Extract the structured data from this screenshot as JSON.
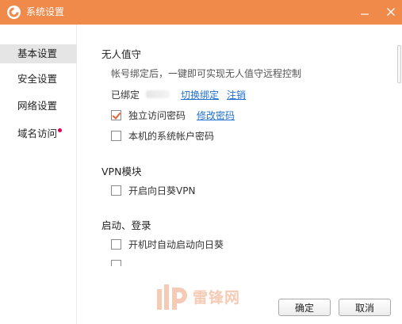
{
  "window": {
    "title": "系统设置",
    "accent_color": "#f08a4b",
    "icons": {
      "app": "sunflower-logo-icon",
      "minimize": "minimize-icon",
      "close": "close-icon"
    }
  },
  "sidebar": {
    "items": [
      {
        "label": "基本设置",
        "active": true
      },
      {
        "label": "安全设置",
        "active": false
      },
      {
        "label": "网络设置",
        "active": false
      },
      {
        "label": "域名访问",
        "active": false,
        "badge": "red-dot"
      }
    ]
  },
  "main": {
    "unattended": {
      "title": "无人值守",
      "description": "帐号绑定后，一键即可实现无人值守远程控制",
      "bound_label": "已绑定",
      "bound_account_masked": true,
      "switch_link": "切换绑定",
      "logout_link": "注销",
      "options": [
        {
          "label": "独立访问密码",
          "checked": true,
          "link": "修改密码"
        },
        {
          "label": "本机的系统帐户密码",
          "checked": false
        }
      ]
    },
    "vpn": {
      "title": "VPN模块",
      "options": [
        {
          "label": "开启向日葵VPN",
          "checked": false
        }
      ]
    },
    "startup": {
      "title": "启动、登录",
      "options": [
        {
          "label": "开机时自动启动向日葵",
          "checked": false
        },
        {
          "label": "",
          "checked": false
        }
      ]
    }
  },
  "footer": {
    "ok_label": "确定",
    "cancel_label": "取消"
  },
  "watermark": {
    "text": "雷锋网",
    "color": "#f0a27a"
  }
}
